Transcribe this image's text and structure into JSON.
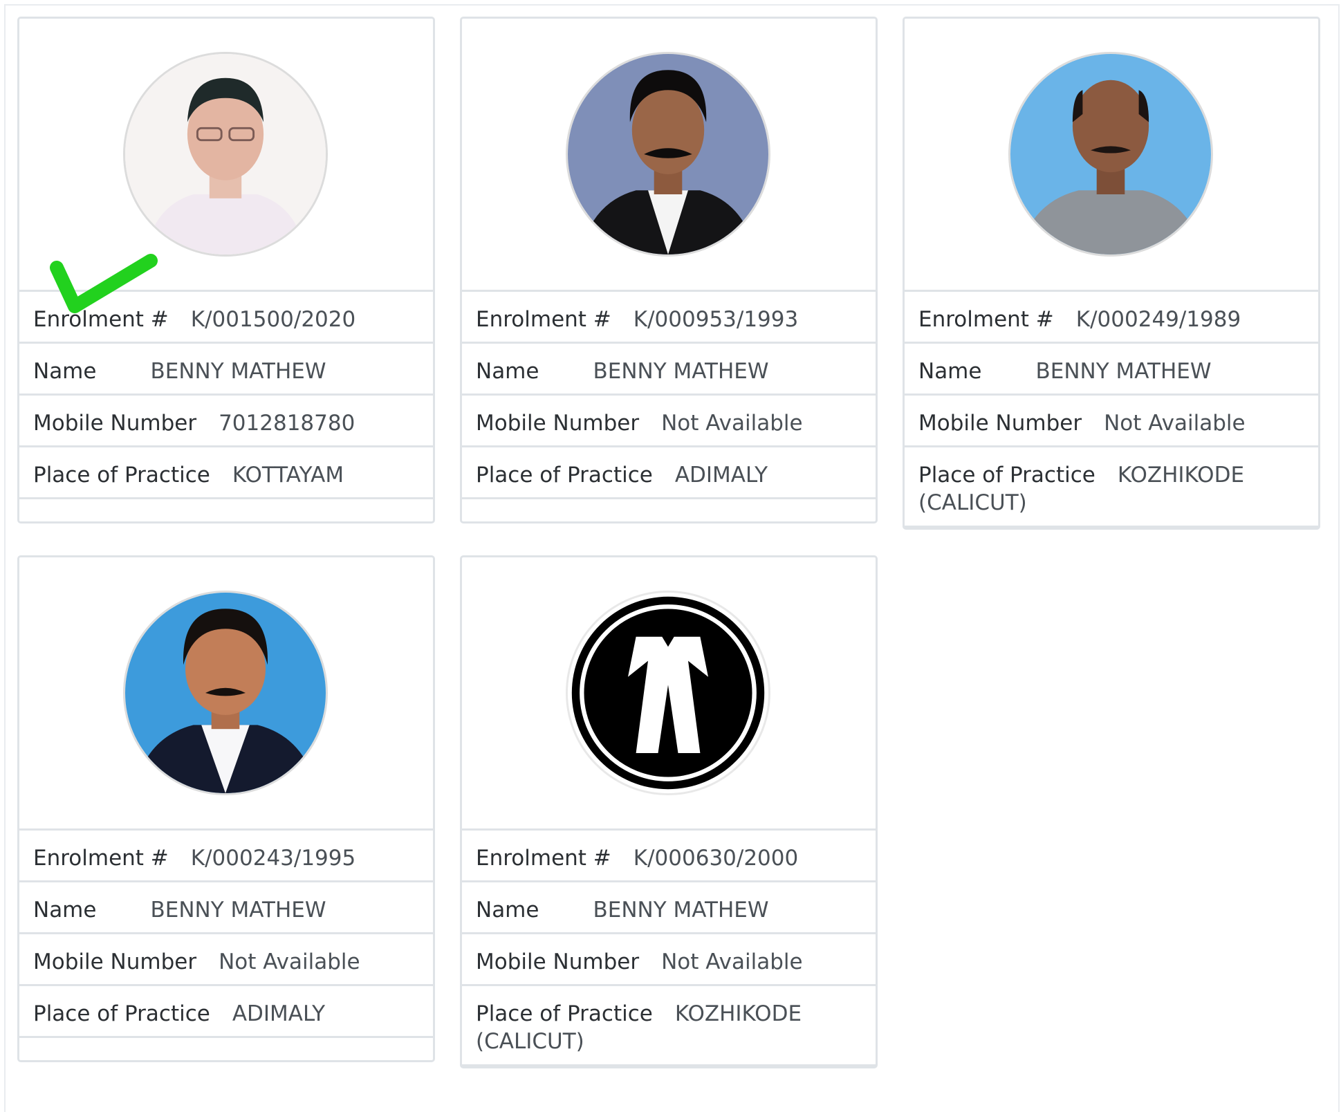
{
  "labels": {
    "enrolment": "Enrolment #",
    "name": "Name",
    "mobile": "Mobile Number",
    "place": "Place of Practice"
  },
  "accent": {
    "check_color": "#22d11e",
    "photo_bg_blue": "#6ab4e8"
  },
  "cards": [
    {
      "enrolment": "K/001500/2020",
      "name": "BENNY MATHEW",
      "mobile": "7012818780",
      "place": "KOTTAYAM",
      "selected": true
    },
    {
      "enrolment": "K/000953/1993",
      "name": "BENNY MATHEW",
      "mobile": "Not Available",
      "place": "ADIMALY",
      "selected": false
    },
    {
      "enrolment": "K/000249/1989",
      "name": "BENNY MATHEW",
      "mobile": "Not Available",
      "place": "KOZHIKODE (CALICUT)",
      "selected": false
    },
    {
      "enrolment": "K/000243/1995",
      "name": "BENNY MATHEW",
      "mobile": "Not Available",
      "place": "ADIMALY",
      "selected": false
    },
    {
      "enrolment": "K/000630/2000",
      "name": "BENNY MATHEW",
      "mobile": "Not Available",
      "place": "KOZHIKODE (CALICUT)",
      "selected": false
    }
  ]
}
